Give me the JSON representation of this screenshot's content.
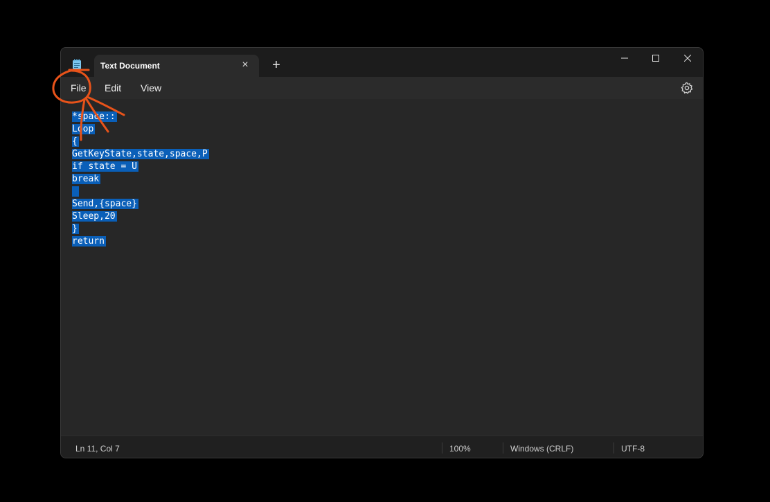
{
  "tab": {
    "title": "Text Document",
    "close_icon": "×",
    "new_tab_icon": "+"
  },
  "menu": {
    "file": "File",
    "edit": "Edit",
    "view": "View"
  },
  "editor": {
    "lines": [
      "*space::",
      "Loop",
      "{",
      "GetKeyState,state,space,P",
      "if state = U",
      "break",
      "",
      "Send,{space}",
      "Sleep,20",
      "}",
      "return"
    ]
  },
  "status": {
    "position": "Ln 11, Col 7",
    "zoom": "100%",
    "line_ending": "Windows (CRLF)",
    "encoding": "UTF-8"
  },
  "colors": {
    "selection": "#0a5fb8",
    "annotation": "#e8531a"
  }
}
